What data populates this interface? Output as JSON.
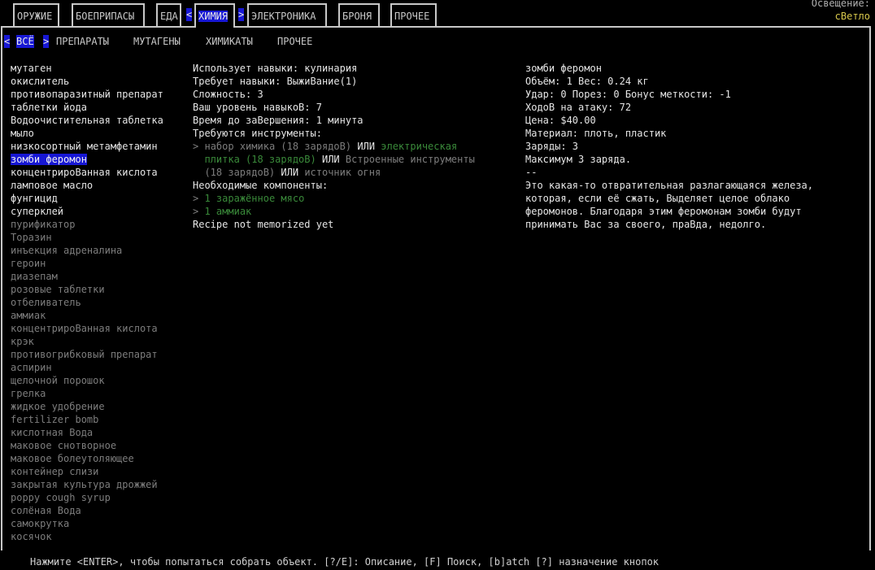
{
  "tabs": [
    {
      "label": "ОРУЖИЕ"
    },
    {
      "label": "БОЕПРИПАСЫ"
    },
    {
      "label": "ЕДА"
    },
    {
      "label": "ХИМИЯ"
    },
    {
      "label": "ЭЛЕКТРОНИКА"
    },
    {
      "label": "БРОНЯ"
    },
    {
      "label": "ПРОЧЕЕ"
    }
  ],
  "arrows": {
    "left": "<",
    "right": ">"
  },
  "lighting": {
    "label": "Освещение:",
    "value": "сВетло"
  },
  "subtabs": [
    {
      "label": "ВСЁ"
    },
    {
      "label": "ПРЕПАРАТЫ"
    },
    {
      "label": "МУТАГЕНЫ"
    },
    {
      "label": "ХИМИКАТЫ"
    },
    {
      "label": "ПРОЧЕЕ"
    }
  ],
  "recipes": [
    "мутаген",
    "окислитель",
    "противопаразитный препарат",
    "таблетки йода",
    "Водоочистительная таблетка",
    "мыло",
    "низкосортный метамфетамин",
    "зомби феромон",
    "концентрироВанная кислота",
    "ламповое масло",
    "фунгицид",
    "суперклей",
    "пурификатор",
    "Торазин",
    "инъекция адреналина",
    "героин",
    "диазепам",
    "розовые таблетки",
    "отбеливатель",
    "аммиак",
    "концентрироВанная кислота",
    "крэк",
    "противогрибковый препарат",
    "аспирин",
    "щелочной порошок",
    "грелка",
    "жидкое удобрение",
    "fertilizer bomb",
    "кислотная Вода",
    "маковое снотворное",
    "маковое болеутоляющее",
    "контейнер слизи",
    "закрытая культура дрожжей",
    "poppy cough syrup",
    "солёная Вода",
    "самокрутка",
    "косячок"
  ],
  "details": {
    "uses_skill": "Использует навыки: кулинария",
    "requires_skill": "Требует навыки: ВыжиВание(1)",
    "difficulty": "Сложность: 3",
    "your_skill": "Ваш уровень навыкоВ: 7",
    "time": "Время до заВершения: 1 минута",
    "tools_header": "Требуются инструменты:",
    "tool_arrow": ">",
    "tool_1": "набор химика (18 зарядоВ)",
    "or": "ИЛИ",
    "tool_2a": "электрическая",
    "tool_2b": "плитка (18 зарядоВ)",
    "tool_3a": "Встроенные инструменты",
    "tool_3b": "(18 зарядоВ)",
    "tool_4": "источник огня",
    "components_header": "Необходимые компоненты:",
    "comp_1": "1 заражённое мясо",
    "comp_2": "1 аммиак",
    "memorized": "Recipe not memorized yet"
  },
  "item": {
    "name": "зомби феромон",
    "volume_weight": "Объём: 1   Вес: 0.24 кг",
    "combat": "Удар: 0 Порез: 0 Бонус меткости: -1",
    "moves": "ХодоВ на атаку: 72",
    "price": "Цена: $40.00",
    "material": "Материал: плоть, пластик",
    "charges": "Заряды: 3",
    "max_charges": "Максимум 3 заряда.",
    "sep": "--",
    "desc_1": "Это какая-то отвратительная разлагающаяся железа,",
    "desc_2": "которая, если её сжать, Выделяет целое облако",
    "desc_3": "феромонов. Благодаря этим феромонам зомби будут",
    "desc_4": "принимать Вас за своего, праВда, недолго."
  },
  "footer": "Нажмите <ENTER>, чтобы попытаться собрать объект.  [?/E]: Описание, [F] Поиск, [b]atch [?] назначение кнопок",
  "colors": {
    "highlight": "#1717d4",
    "available": "#e6e6e6",
    "unavailable": "#7d7d7d",
    "tool_ok": "#3a8a3a",
    "lighting": "#d8c84c"
  }
}
